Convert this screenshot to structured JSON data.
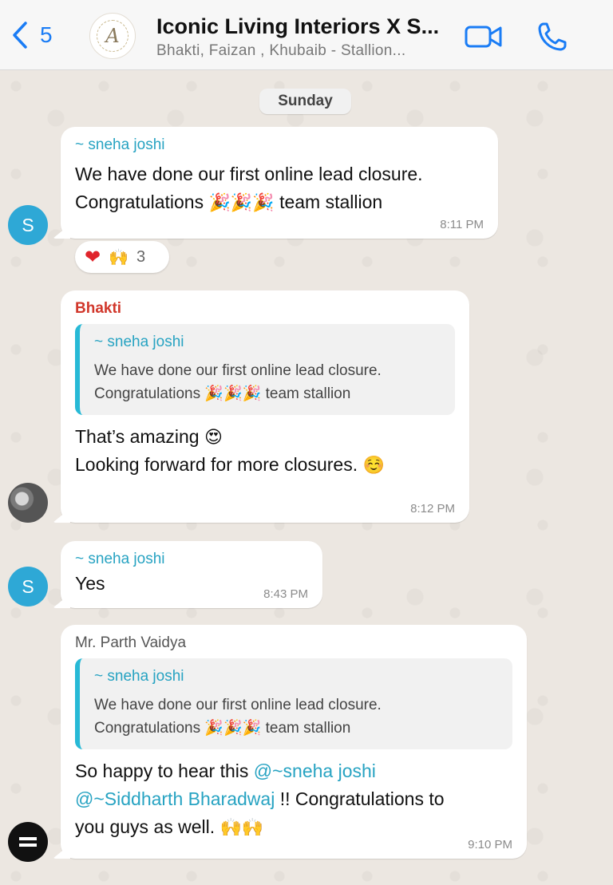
{
  "header": {
    "back_count": "5",
    "avatar_letter": "A",
    "title": "Iconic Living Interiors X S...",
    "subtitle": "Bhakti, Faizan , Khubaib - Stallion..."
  },
  "date_chip": "Sunday",
  "messages": [
    {
      "sender": "~ sneha joshi",
      "line1": "We have done our first online lead closure.",
      "line2_pre": "Congratulations ",
      "line2_emoji": "🎉🎉🎉",
      "line2_post": " team stallion",
      "time": "8:11 PM",
      "avatar_letter": "S",
      "reactions": {
        "heart": "❤",
        "hands": "🙌",
        "count": "3"
      }
    },
    {
      "sender": "Bhakti",
      "quote_sender": "~ sneha joshi",
      "quote_line1": "We have done our first online lead closure.",
      "quote_line2_pre": "Congratulations ",
      "quote_line2_emoji": "🎉🎉🎉",
      "quote_line2_post": " team stallion",
      "line1": "That’s amazing",
      "line1_emoji": "😍",
      "line2": "Looking forward for more closures.",
      "line2_emoji": "☺️",
      "time": "8:12 PM"
    },
    {
      "sender": "~ sneha joshi",
      "text": "Yes",
      "time": "8:43 PM",
      "avatar_letter": "S"
    },
    {
      "sender": "Mr. Parth Vaidya",
      "quote_sender": "~ sneha joshi",
      "quote_line1": "We have done our first online lead closure.",
      "quote_line2_pre": "Congratulations ",
      "quote_line2_emoji": "🎉🎉🎉",
      "quote_line2_post": " team stallion",
      "line1_pre": "So happy to hear this ",
      "mention1": "@~sneha joshi",
      "mention2": "@~Siddharth Bharadwaj",
      "line2_post": " !! Congratulations to",
      "line3": "you guys as well. ",
      "line3_emoji": "🙌🙌",
      "time": "9:10 PM"
    }
  ]
}
